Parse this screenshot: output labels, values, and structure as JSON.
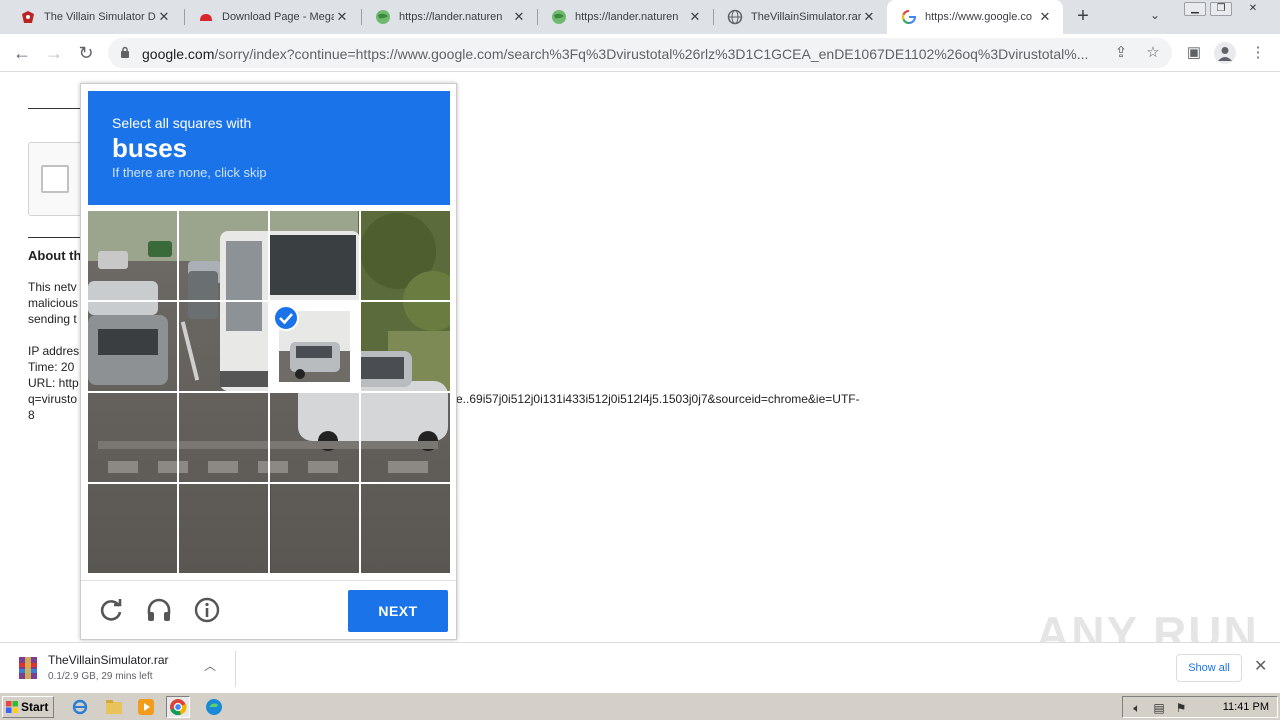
{
  "browser": {
    "tabs": [
      {
        "title": "The Villain Simulator Do",
        "icon": "villain-favicon-icon",
        "active": false
      },
      {
        "title": "Download Page - Mega",
        "icon": "mega-favicon-icon",
        "active": false
      },
      {
        "title": "https://lander.naturen",
        "icon": "globe-green-favicon-icon",
        "active": false
      },
      {
        "title": "https://lander.naturen",
        "icon": "globe-green-favicon-icon",
        "active": false
      },
      {
        "title": "TheVillainSimulator.rar",
        "icon": "globe-gray-favicon-icon",
        "active": false
      },
      {
        "title": "https://www.google.co",
        "icon": "google-favicon-icon",
        "active": true
      }
    ],
    "new_tab_label": "+",
    "url_host": "google.com",
    "url_rest": "/sorry/index?continue=https://www.google.com/search%3Fq%3Dvirustotal%26rlz%3D1C1GCEA_enDE1067DE1102%26oq%3Dvirustotal%..."
  },
  "page": {
    "about_heading": "About th",
    "para_lines": [
      "This netv",
      "malicious",
      "sending t"
    ],
    "info_lines": [
      "IP addres",
      "Time: 20",
      "URL: http"
    ],
    "url_line_left": "q=virusto",
    "url_line_right": "e..69i57j0i512j0i131i433i512j0i512l4j5.1503j0j7&sourceid=chrome&ie=UTF-",
    "url_line_end": "8"
  },
  "captcha": {
    "prompt": "Select all squares with",
    "target": "buses",
    "hint": "If there are none, click skip",
    "next_label": "NEXT",
    "selected_tiles": [
      5
    ]
  },
  "download": {
    "filename": "TheVillainSimulator.rar",
    "status": "0.1/2.9 GB, 29 mins left",
    "show_all": "Show all"
  },
  "watermark": "ANY RUN",
  "taskbar": {
    "start_label": "Start",
    "clock": "11:41 PM"
  },
  "colors": {
    "accent": "#1a73e8",
    "tabstrip": "#dee1e6",
    "taskbar": "#d4d0c8"
  }
}
